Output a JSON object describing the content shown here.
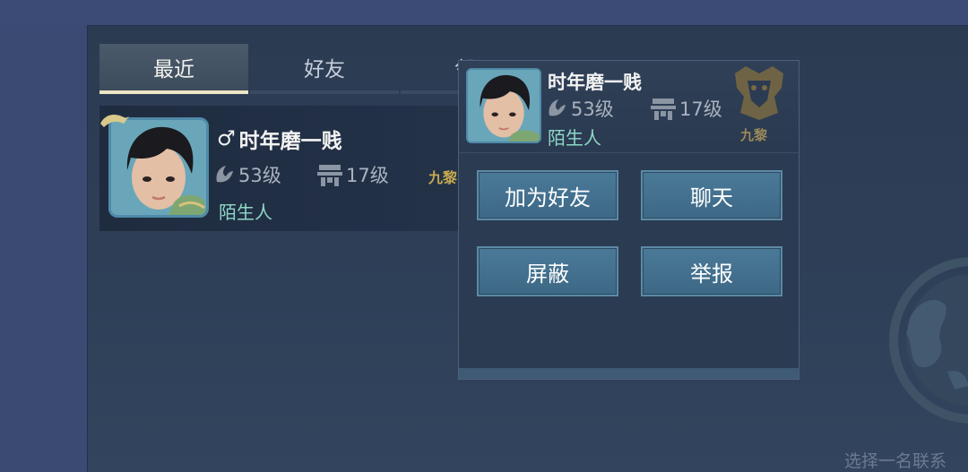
{
  "tabs": [
    {
      "label": "最近",
      "active": true
    },
    {
      "label": "好友",
      "active": false
    },
    {
      "label": "邻居",
      "active": false
    }
  ],
  "contact": {
    "gender_symbol": "♂",
    "name": "时年磨一贱",
    "level": "53级",
    "home_level": "17级",
    "relation": "陌生人",
    "guild": "九黎"
  },
  "popup": {
    "name": "时年磨一贱",
    "level": "53级",
    "home_level": "17级",
    "relation": "陌生人",
    "guild": "九黎",
    "buttons": {
      "add_friend": "加为好友",
      "chat": "聊天",
      "block": "屏蔽",
      "report": "举报"
    }
  },
  "hint": "选择一名联系",
  "icons": {
    "level": "wing-level-icon",
    "home": "house-level-icon",
    "guild": "guild-emblem-icon",
    "globe": "globe-icon"
  },
  "colors": {
    "relation": "#8fd7c6",
    "guild": "#c7a94d",
    "button": "#3d6886",
    "active_tab_underline": "#ece6c2"
  }
}
